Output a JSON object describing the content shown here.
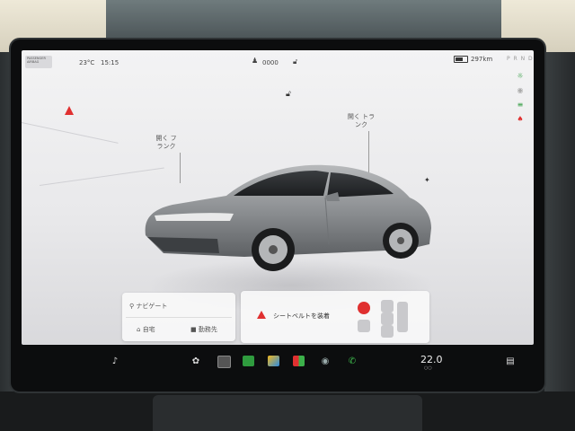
{
  "status_bar": {
    "airbag_label": "PASSENGER AIRBAG",
    "temperature": "23°C",
    "time": "15:15",
    "profile_name": "0000",
    "range": "297km",
    "gear": "P R N D",
    "battery_level": 0.7
  },
  "car_view": {
    "frunk_label": "開く フランク",
    "trunk_label": "開く トランク"
  },
  "navigation": {
    "search_placeholder": "ナビゲート",
    "home_label": "自宅",
    "work_label": "勤務先"
  },
  "alert": {
    "message": "シートベルトを装着"
  },
  "taskbar": {
    "climate_temp": "22.0",
    "climate_unit": "○○"
  },
  "colors": {
    "alert_red": "#e03030",
    "screen_bg": "#efeff0",
    "car_body": "#8f9294"
  },
  "icons": [
    "volume-icon",
    "fan-icon",
    "glovebox-icon",
    "energy-app-icon",
    "games-app-icon",
    "apps-icon",
    "camera-icon",
    "phone-icon",
    "seat-heater-icon",
    "headlight-icon",
    "fog-light-icon",
    "seatbelt-icon",
    "lock-icon",
    "profile-icon",
    "charge-port-icon",
    "search-icon",
    "home-icon",
    "work-icon",
    "warning-icon"
  ]
}
